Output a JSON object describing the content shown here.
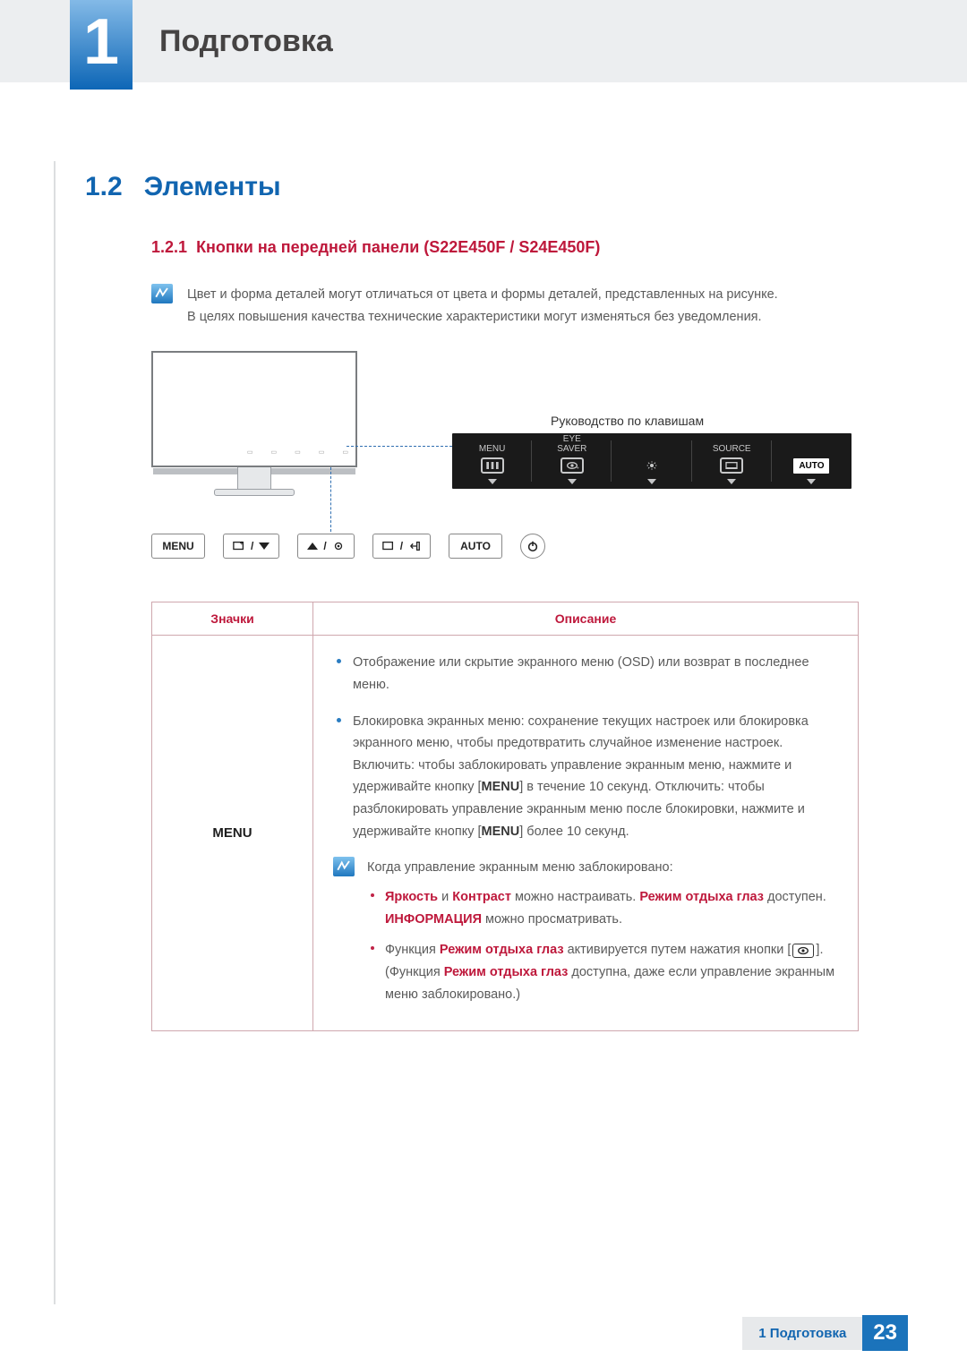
{
  "chapter": {
    "number": "1",
    "title": "Подготовка"
  },
  "section": {
    "number": "1.2",
    "title": "Элементы"
  },
  "subsection": {
    "number": "1.2.1",
    "title": "Кнопки на передней панели (S22E450F / S24E450F)"
  },
  "note": {
    "line1": "Цвет и форма деталей могут отличаться от цвета и формы деталей, представленных на рисунке.",
    "line2": "В целях повышения качества технические характеристики могут изменяться без уведомления."
  },
  "figure": {
    "key_guide_label": "Руководство по клавишам",
    "panel": {
      "menu": "MENU",
      "eye_saver": "EYE\nSAVER",
      "source": "SOURCE",
      "auto": "AUTO"
    },
    "physical_buttons": {
      "menu": "MENU",
      "auto": "AUTO"
    }
  },
  "table": {
    "headers": {
      "icons": "Значки",
      "description": "Описание"
    },
    "row1": {
      "icon_label": "MENU",
      "bullet1": "Отображение или скрытие экранного меню (OSD) или возврат в последнее меню.",
      "bullet2_pre": "Блокировка экранных меню: сохранение текущих настроек или блокировка экранного меню, чтобы предотвратить случайное изменение настроек. Включить: чтобы заблокировать управление экранным меню, нажмите и удерживайте кнопку [",
      "bullet2_mid1": "MENU",
      "bullet2_post1": "] в течение 10 секунд. Отключить: чтобы разблокировать управление экранным меню после блокировки, нажмите и удерживайте кнопку [",
      "bullet2_mid2": "MENU",
      "bullet2_post2": "] более 10 секунд.",
      "locked_note": "Когда управление экранным меню заблокировано:",
      "sb1_a": "Яркость",
      "sb1_b": " и ",
      "sb1_c": "Контраст",
      "sb1_d": " можно настраивать. ",
      "sb1_e": "Режим отдыха глаз",
      "sb1_f": " доступен. ",
      "sb1_g": "ИНФОРМАЦИЯ",
      "sb1_h": " можно просматривать.",
      "sb2_a": "Функция ",
      "sb2_b": "Режим отдыха глаз",
      "sb2_c": " активируется путем нажатия кнопки [",
      "sb2_d": "]. (Функция ",
      "sb2_e": "Режим отдыха глаз",
      "sb2_f": " доступна, даже если управление экранным меню заблокировано.)"
    }
  },
  "footer": {
    "label": "1 Подготовка",
    "page": "23"
  }
}
